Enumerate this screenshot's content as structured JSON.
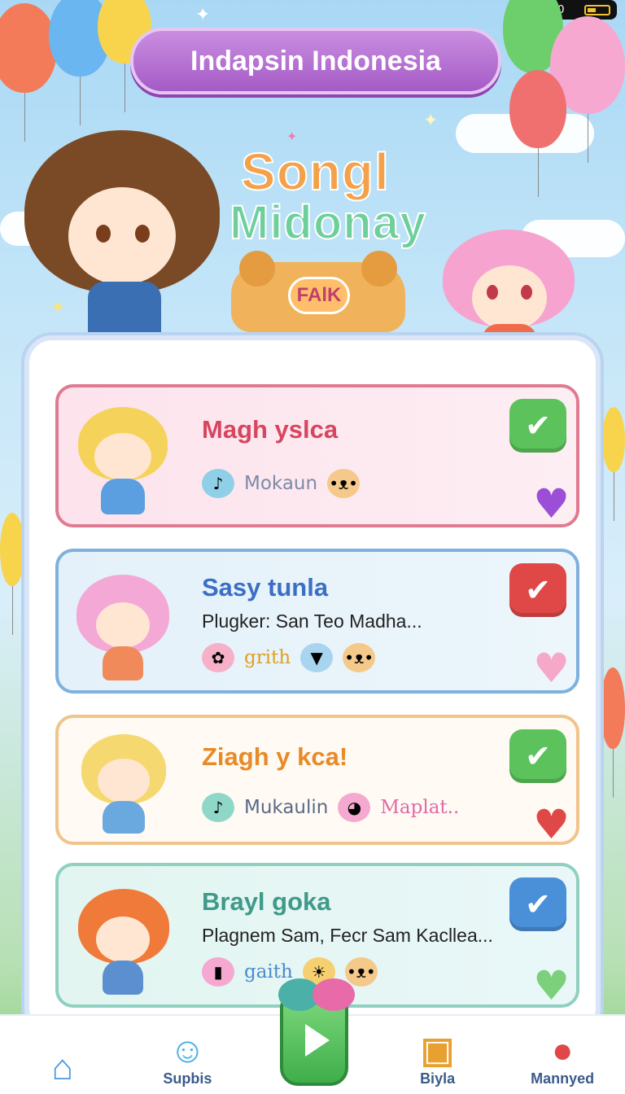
{
  "status_bar": {
    "time": "12:50"
  },
  "header": {
    "title": "Indapsin Indonesia"
  },
  "logo": {
    "line1": "Songl",
    "line2": "Midonay",
    "tag": "FAlK"
  },
  "cards": [
    {
      "title": "Magh yslca",
      "subtitle": "",
      "meta": [
        "Mokaun"
      ],
      "title_color": "#d8455f",
      "border": "#e07a90",
      "bg": "#fde3ec",
      "check_color": "#5cc25c",
      "heart_color": "#9b4fd6"
    },
    {
      "title": "Sasy tunla",
      "subtitle": "Plugker: San Teo Madha...",
      "meta": [
        "grith"
      ],
      "title_color": "#3b6fc4",
      "border": "#7fb0de",
      "bg": "#e4f1fa",
      "check_color": "#e04848",
      "heart_color": "#f5a8c8"
    },
    {
      "title": "Ziagh y kca!",
      "subtitle": "",
      "meta": [
        "Mukaulin",
        "Maplat.."
      ],
      "title_color": "#e88a28",
      "border": "#f0c48a",
      "bg": "#fffaf3",
      "check_color": "#5cc25c",
      "heart_color": "#e04848"
    },
    {
      "title": "Brayl goka",
      "subtitle": "Plagnem Sam, Fecr Sam Kacllea...",
      "meta": [
        "gaith"
      ],
      "title_color": "#3f9a8a",
      "border": "#8fd0c0",
      "bg": "#e2f5f0",
      "check_color": "#4a90d8",
      "heart_color": "#7cd07c"
    }
  ],
  "nav": [
    {
      "label": "",
      "icon": "home-icon"
    },
    {
      "label": "Supbis",
      "icon": "bow-face-icon"
    },
    {
      "label": "",
      "icon": "play-icon"
    },
    {
      "label": "Biyla",
      "icon": "box-icon"
    },
    {
      "label": "Mannyed",
      "icon": "pin-icon"
    }
  ],
  "colors": {
    "banner": "#a55bc7",
    "accent_green": "#3fae4a"
  }
}
